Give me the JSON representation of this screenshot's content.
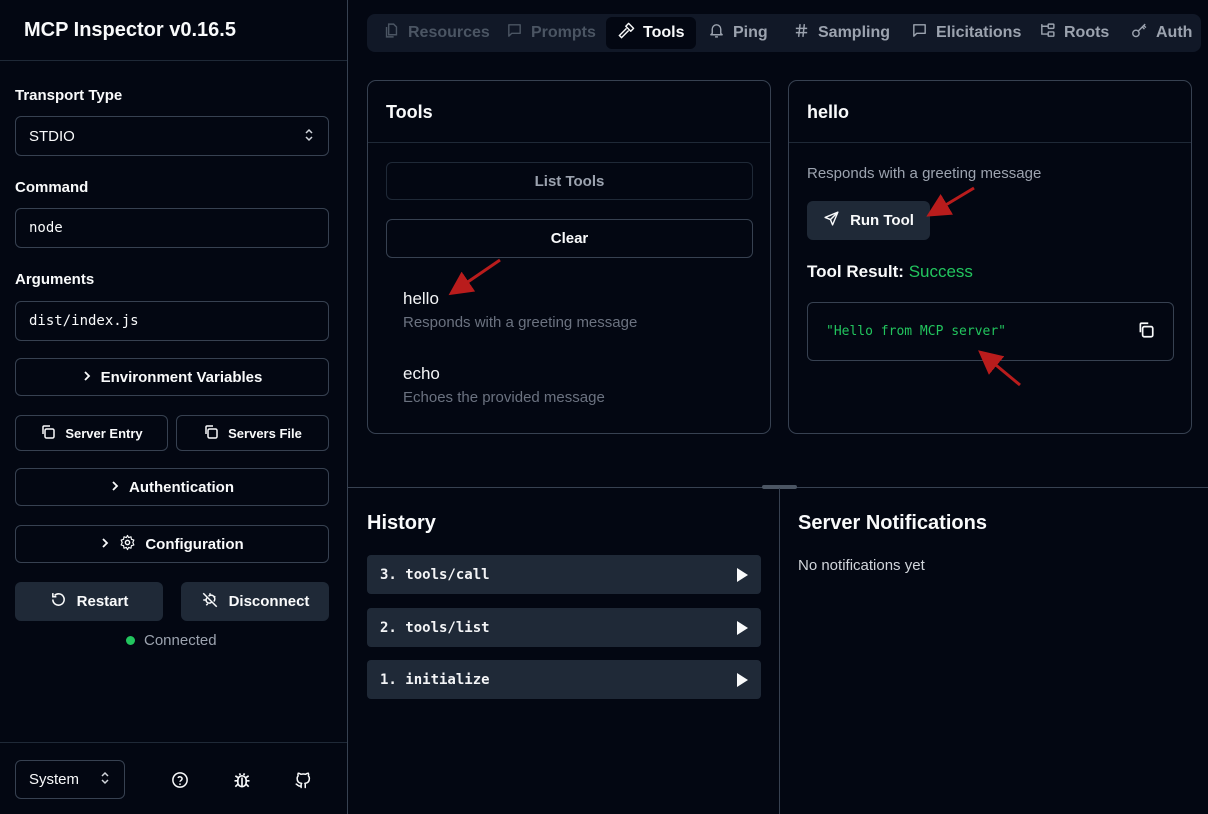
{
  "app": {
    "title": "MCP Inspector v0.16.5"
  },
  "connection": {
    "transport_label": "Transport Type",
    "transport_value": "STDIO",
    "command_label": "Command",
    "command_value": "node",
    "arguments_label": "Arguments",
    "arguments_value": "dist/index.js",
    "env_vars": "Environment Variables",
    "server_entry": "Server Entry",
    "servers_file": "Servers File",
    "authentication": "Authentication",
    "configuration": "Configuration",
    "restart": "Restart",
    "disconnect": "Disconnect",
    "status": "Connected",
    "status_color": "#22c55e"
  },
  "footer": {
    "theme": "System",
    "icons": [
      "help-circle-icon",
      "bug-icon",
      "github-icon"
    ]
  },
  "tabs": [
    {
      "label": "Resources",
      "icon": "files-icon",
      "state": "disabled"
    },
    {
      "label": "Prompts",
      "icon": "message-square-icon",
      "state": "disabled"
    },
    {
      "label": "Tools",
      "icon": "hammer-icon",
      "state": "active"
    },
    {
      "label": "Ping",
      "icon": "bell-icon",
      "state": "normal"
    },
    {
      "label": "Sampling",
      "icon": "hash-icon",
      "state": "normal"
    },
    {
      "label": "Elicitations",
      "icon": "message-square-icon",
      "state": "normal"
    },
    {
      "label": "Roots",
      "icon": "folder-tree-icon",
      "state": "normal"
    },
    {
      "label": "Auth",
      "icon": "key-icon",
      "state": "normal"
    }
  ],
  "tools_panel": {
    "title": "Tools",
    "list_button": "List Tools",
    "clear_button": "Clear",
    "tools": [
      {
        "name": "hello",
        "description": "Responds with a greeting message"
      },
      {
        "name": "echo",
        "description": "Echoes the provided message"
      }
    ]
  },
  "tool_detail": {
    "title": "hello",
    "description": "Responds with a greeting message",
    "run_button": "Run Tool",
    "result_label": "Tool Result:",
    "result_status": "Success",
    "result_text": "\"Hello from MCP server\""
  },
  "history": {
    "title": "History",
    "items": [
      "3. tools/call",
      "2. tools/list",
      "1. initialize"
    ]
  },
  "notifications": {
    "title": "Server Notifications",
    "empty": "No notifications yet"
  },
  "colors": {
    "background": "#030712",
    "success": "#22c55e",
    "annotation_arrow": "#b91c1c"
  }
}
